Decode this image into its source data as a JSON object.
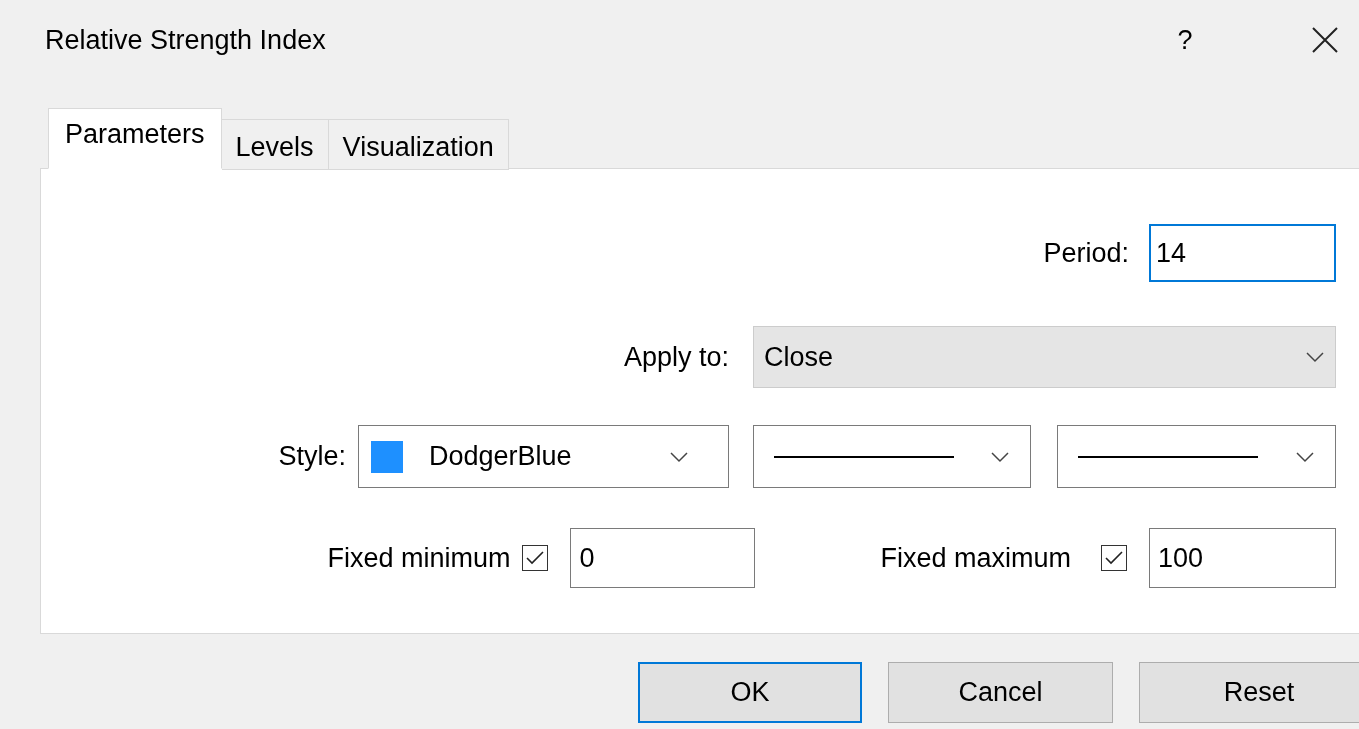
{
  "window": {
    "title": "Relative Strength Index",
    "help": "?"
  },
  "tabs": [
    {
      "label": "Parameters",
      "selected": true
    },
    {
      "label": "Levels",
      "selected": false
    },
    {
      "label": "Visualization",
      "selected": false
    }
  ],
  "period": {
    "label": "Period:",
    "value": "14",
    "focused": true
  },
  "apply_to": {
    "label": "Apply to:",
    "value": "Close"
  },
  "style": {
    "label": "Style:",
    "color_name": "DodgerBlue",
    "color": "#1e90ff"
  },
  "fixed_minimum": {
    "label": "Fixed minimum",
    "checked": true,
    "value": "0"
  },
  "fixed_maximum": {
    "label": "Fixed maximum",
    "checked": true,
    "value": "100"
  },
  "buttons": [
    {
      "label": "OK",
      "default": true
    },
    {
      "label": "Cancel",
      "default": false
    },
    {
      "label": "Reset",
      "default": false
    }
  ]
}
